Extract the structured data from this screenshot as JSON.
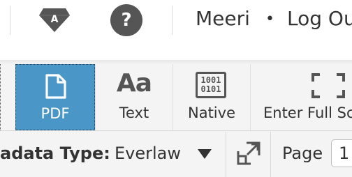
{
  "top_bar": {
    "user_name": "Meeri",
    "separator": "•",
    "logout_label": "Log Ou",
    "gem_badge_letter": "A",
    "help_symbol": "?",
    "icons": [
      "gem-badge-icon",
      "help-circle-icon"
    ]
  },
  "viewer_toolbar": {
    "tools": [
      {
        "id": "pdf",
        "label": "PDF",
        "icon": "pdf-document-icon",
        "active": true
      },
      {
        "id": "text",
        "label": "Text",
        "icon": "text-aa-icon",
        "glyph": "Aa",
        "active": false
      },
      {
        "id": "native",
        "label": "Native",
        "icon": "binary-file-icon",
        "glyph_lines": [
          "1001",
          "0101"
        ],
        "active": false
      },
      {
        "id": "fullscreen",
        "label": "Enter Full Sc",
        "icon": "fullscreen-corners-icon",
        "active": false
      }
    ]
  },
  "metadata_bar": {
    "type_label": "adata Type:",
    "type_value": "Everlaw",
    "popout_icon": "popout-icon",
    "page_label": "Page",
    "page_value": "1"
  },
  "colors": {
    "active_tool_bg": "#4a96c6",
    "toolbar_bg": "#f4f4f4",
    "icon_gray": "#555555",
    "text": "#333333"
  }
}
